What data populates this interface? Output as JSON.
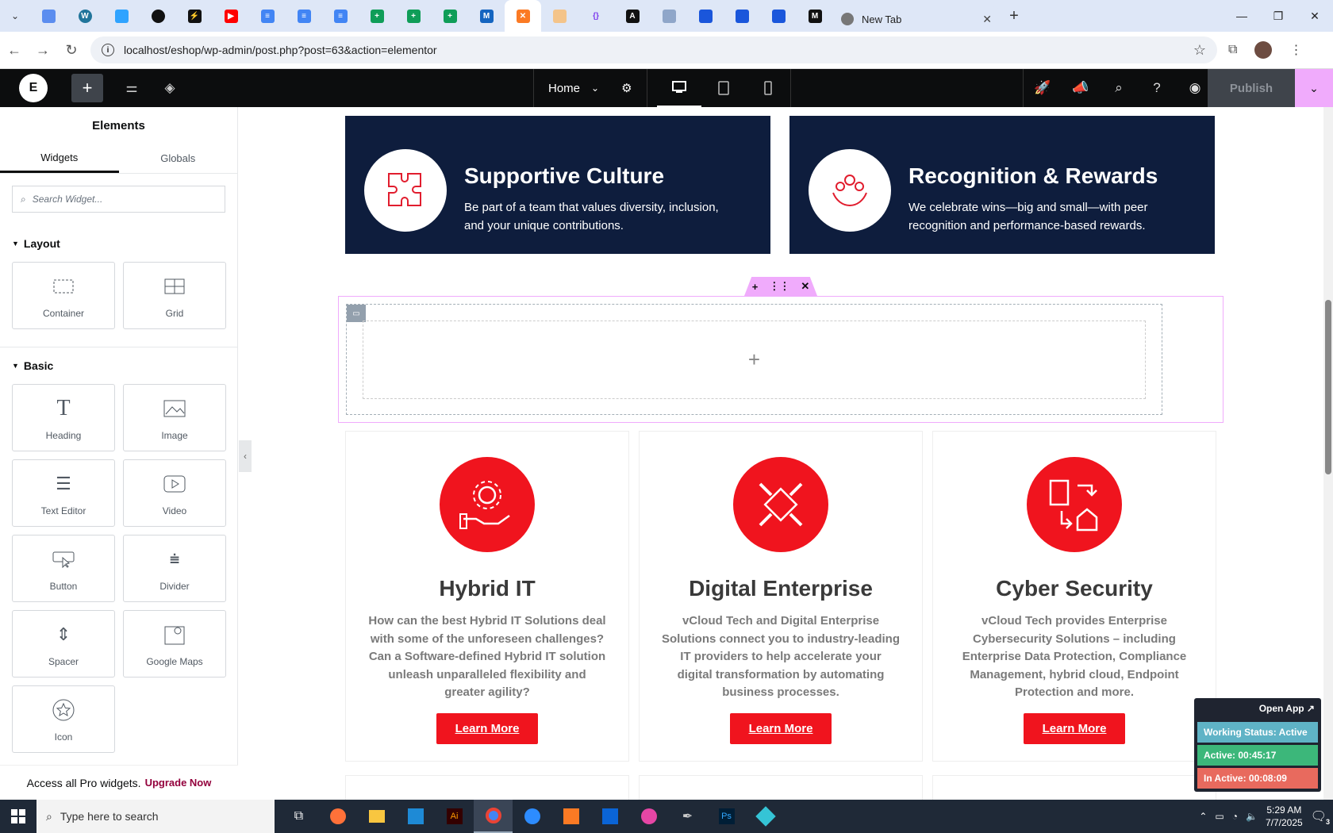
{
  "browser": {
    "new_tab_title": "New Tab",
    "url": "localhost/eshop/wp-admin/post.php?post=63&action=elementor"
  },
  "editor": {
    "page_name": "Home",
    "publish_label": "Publish"
  },
  "panel": {
    "title": "Elements",
    "tabs": [
      "Widgets",
      "Globals"
    ],
    "search_placeholder": "Search Widget...",
    "layout_title": "Layout",
    "layout_widgets": [
      "Container",
      "Grid"
    ],
    "basic_title": "Basic",
    "basic_widgets": [
      "Heading",
      "Image",
      "Text Editor",
      "Video",
      "Button",
      "Divider",
      "Spacer",
      "Google Maps",
      "Icon"
    ],
    "pro_text": "Access all Pro widgets.",
    "pro_link": "Upgrade Now"
  },
  "canvas": {
    "top_cards": [
      {
        "title": "Supportive Culture",
        "text": "Be part of a team that values diversity, inclusion, and your unique contributions."
      },
      {
        "title": "Recognition & Rewards",
        "text": "We celebrate wins—big and small—with peer recognition and performance-based rewards."
      }
    ],
    "services": [
      {
        "title": "Hybrid IT",
        "text": "How can the best Hybrid IT Solutions deal with some of the unforeseen challenges? Can a Software-defined Hybrid IT solution unleash unparalleled flexibility and greater agility?",
        "button": "Learn More"
      },
      {
        "title": "Digital Enterprise",
        "text": "vCloud Tech and Digital Enterprise Solutions connect you to industry-leading IT providers to help accelerate your digital transformation by automating business processes.",
        "button": "Learn More"
      },
      {
        "title": "Cyber Security",
        "text": "vCloud Tech provides Enterprise Cybersecurity Solutions – including Enterprise Data Protection, Compliance Management, hybrid cloud, Endpoint Protection and more.",
        "button": "Learn More"
      }
    ]
  },
  "time_widget": {
    "open_app": "Open App ↗",
    "working_status": "Working Status: Active",
    "active": "Active: 00:45:17",
    "inactive": "In Active: 00:08:09"
  },
  "taskbar": {
    "search_placeholder": "Type here to search",
    "time": "5:29 AM",
    "date": "7/7/2025",
    "notif_count": "3"
  },
  "colors": {
    "accent_red": "#f0141e",
    "navy": "#0e1d3d",
    "elementor_pink": "#f0abfc"
  }
}
